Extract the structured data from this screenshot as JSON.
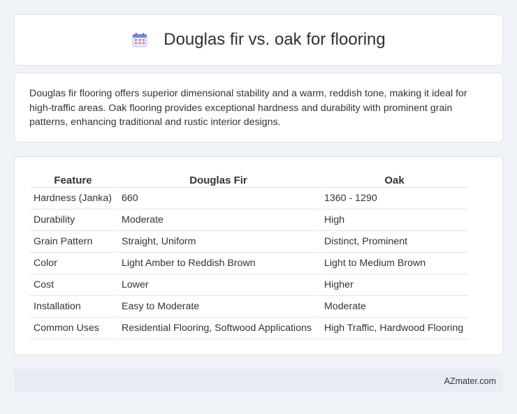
{
  "header": {
    "title": "Douglas fir vs. oak for flooring",
    "icon": "calendar-icon"
  },
  "description": "Douglas fir flooring offers superior dimensional stability and a warm, reddish tone, making it ideal for high-traffic areas. Oak flooring provides exceptional hardness and durability with prominent grain patterns, enhancing traditional and rustic interior designs.",
  "table": {
    "headers": [
      "Feature",
      "Douglas Fir",
      "Oak"
    ],
    "rows": [
      [
        "Hardness (Janka)",
        "660",
        "1360 - 1290"
      ],
      [
        "Durability",
        "Moderate",
        "High"
      ],
      [
        "Grain Pattern",
        "Straight, Uniform",
        "Distinct, Prominent"
      ],
      [
        "Color",
        "Light Amber to Reddish Brown",
        "Light to Medium Brown"
      ],
      [
        "Cost",
        "Lower",
        "Higher"
      ],
      [
        "Installation",
        "Easy to Moderate",
        "Moderate"
      ],
      [
        "Common Uses",
        "Residential Flooring, Softwood Applications",
        "High Traffic, Hardwood Flooring"
      ]
    ]
  },
  "footer": {
    "brand": "AZmater.com"
  }
}
